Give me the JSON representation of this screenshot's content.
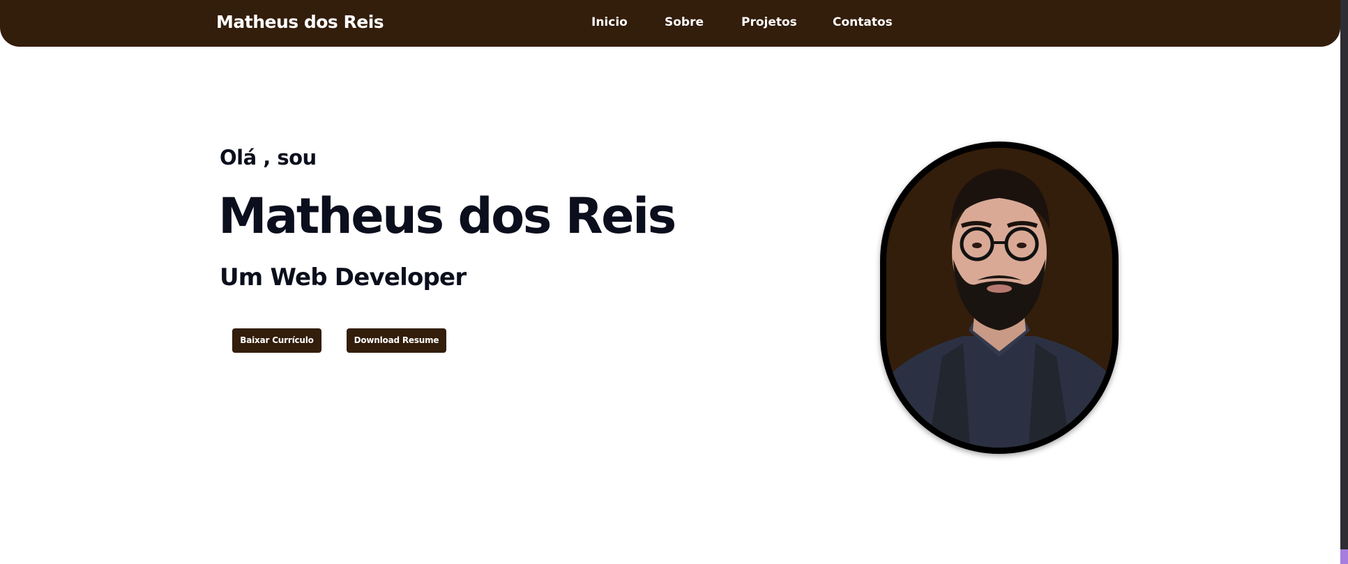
{
  "header": {
    "brand": "Matheus dos Reis",
    "nav": [
      {
        "label": "Inicio"
      },
      {
        "label": "Sobre"
      },
      {
        "label": "Projetos"
      },
      {
        "label": "Contatos"
      }
    ],
    "background_color": "#331d0b"
  },
  "hero": {
    "greeting": "Olá , sou",
    "name": "Matheus dos Reis",
    "role": "Um Web Developer",
    "buttons": {
      "cv_label": "Baixar Currículo",
      "resume_label": "Download Resume"
    },
    "accent_color": "#331d0b",
    "text_color": "#0b0e1c"
  },
  "portrait": {
    "icon": "profile-photo"
  }
}
